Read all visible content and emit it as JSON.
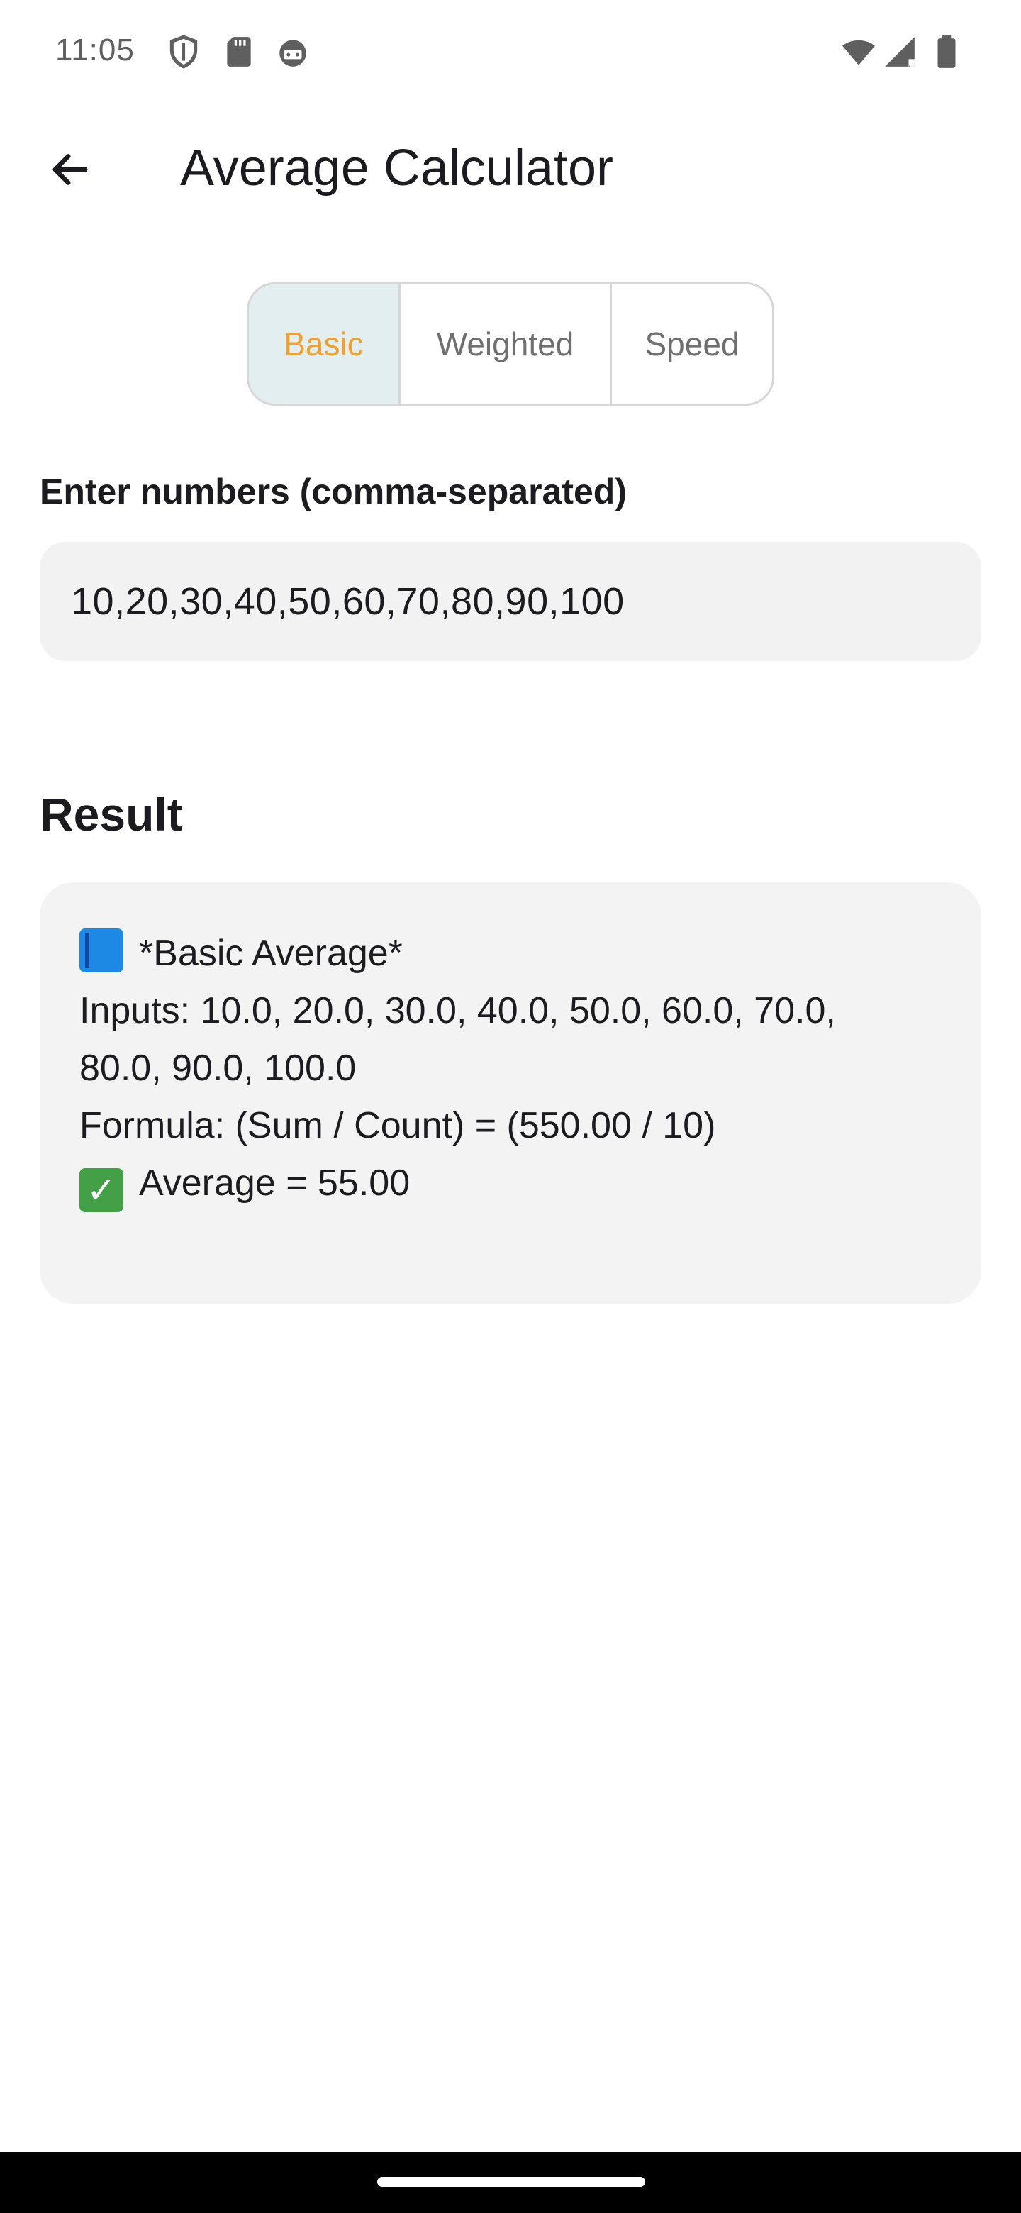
{
  "status_bar": {
    "time": "11:05",
    "left_icons": [
      "shield-icon",
      "sd-card-icon",
      "android-debug-icon"
    ],
    "right_icons": [
      "wifi-icon",
      "cell-signal-icon",
      "battery-icon"
    ]
  },
  "app_bar": {
    "back_icon": "arrow-back-icon",
    "title": "Average Calculator"
  },
  "tabs": [
    {
      "label": "Basic",
      "selected": true
    },
    {
      "label": "Weighted",
      "selected": false
    },
    {
      "label": "Speed",
      "selected": false
    }
  ],
  "input": {
    "label": "Enter numbers (comma-separated)",
    "value": "10,20,30,40,50,60,70,80,90,100"
  },
  "result": {
    "heading": "Result",
    "title_emoji": "blue-book-emoji",
    "title": "*Basic Average*",
    "inputs_line_1": "Inputs: 10.0, 20.0, 30.0, 40.0, 50.0, 60.0, 70.0,",
    "inputs_line_2": "80.0, 90.0, 100.0",
    "formula": "Formula: (Sum / Count) = (550.00 / 10)",
    "answer_emoji": "check-mark-emoji",
    "answer": "Average = 55.00"
  },
  "colors": {
    "selected_tab_bg": "#e3eef0",
    "selected_tab_text": "#f0a030",
    "field_bg": "#f2f2f2"
  }
}
